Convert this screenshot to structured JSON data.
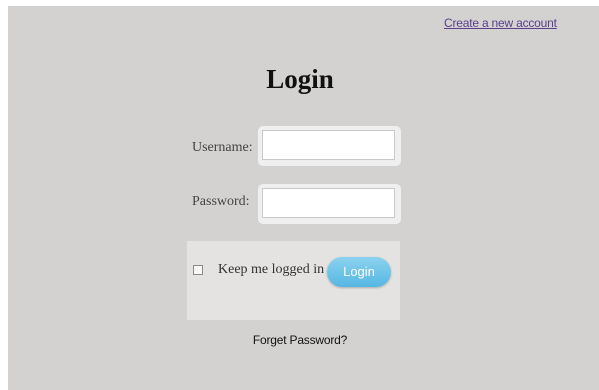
{
  "header": {
    "create_account_link": "Create a new account"
  },
  "form": {
    "title": "Login",
    "username_label": "Username:",
    "username_value": "",
    "password_label": "Password:",
    "password_value": "",
    "remember_label": "Keep me logged in",
    "remember_checked": false,
    "login_button": "Login",
    "forget_password_link": "Forget Password?"
  },
  "colors": {
    "background": "#d3d2d1",
    "link": "#5a3f8a",
    "button": "#55b7e3"
  }
}
